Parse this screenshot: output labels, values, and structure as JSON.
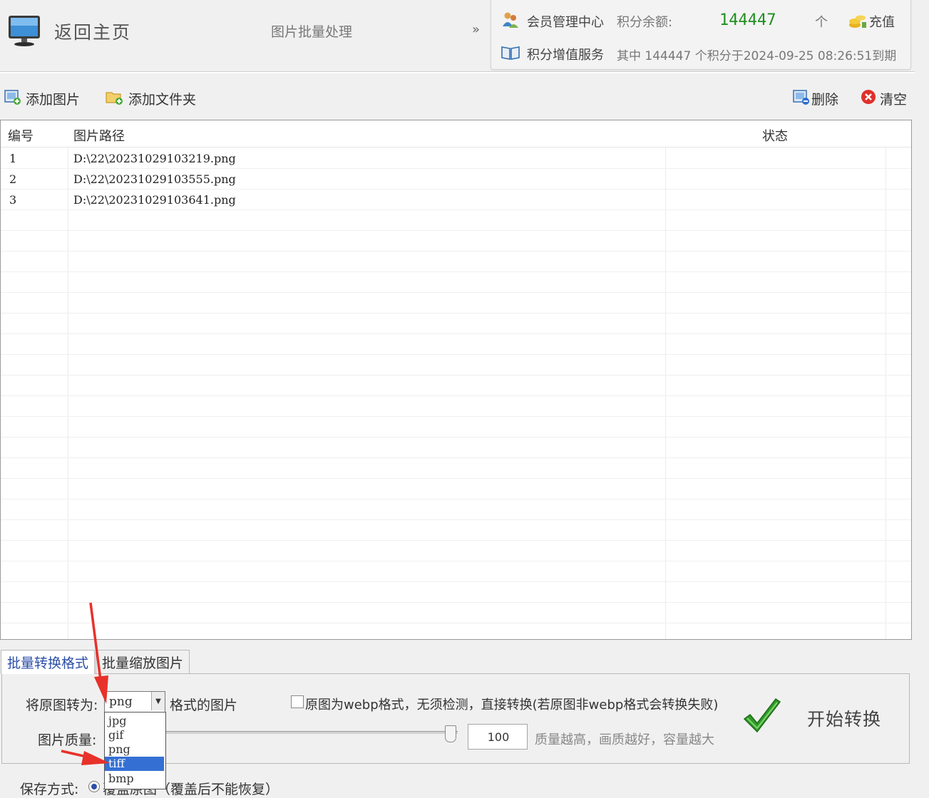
{
  "header": {
    "home_label": "返回主页",
    "module_title": "图片批量处理",
    "collapse_glyph": "»",
    "member_center": "会员管理中心",
    "balance_label": "积分余额:",
    "balance_value": "144447",
    "balance_unit": "个",
    "recharge_label": "充值",
    "value_service": "积分增值服务",
    "expiry_text": "其中 144447 个积分于2024-09-25 08:26:51到期",
    "icons": [
      "monitor-icon",
      "members-icon",
      "coins-icon",
      "book-icon"
    ]
  },
  "toolbar": {
    "add_image": "添加图片",
    "add_folder": "添加文件夹",
    "delete": "删除",
    "clear": "清空"
  },
  "table": {
    "columns": [
      "编号",
      "图片路径",
      "状态"
    ],
    "rows": [
      {
        "id": "1",
        "path": "D:\\22\\20231029103219.png",
        "status": ""
      },
      {
        "id": "2",
        "path": "D:\\22\\20231029103555.png",
        "status": ""
      },
      {
        "id": "3",
        "path": "D:\\22\\20231029103641.png",
        "status": ""
      }
    ]
  },
  "tabs": [
    {
      "label": "批量转换格式",
      "active": true
    },
    {
      "label": "批量缩放图片",
      "active": false
    }
  ],
  "convert": {
    "convert_label": "将原图转为:",
    "selected_format": "png",
    "format_suffix": "格式的图片",
    "format_options": [
      "jpg",
      "gif",
      "png",
      "tiff",
      "bmp"
    ],
    "highlighted_option": "tiff",
    "webp_checkbox_label": "原图为webp格式，无须检测，直接转换(若原图非webp格式会转换失败)",
    "webp_checked": false,
    "quality_label": "图片质量:",
    "quality_value": "100",
    "quality_hint": "质量越高，画质越好，容量越大",
    "start_button": "开始转换",
    "save_label": "保存方式:",
    "save_option": "覆盖原图（覆盖后不能恢复）"
  },
  "colors": {
    "balance": "#1f8f1f",
    "active_tab_text": "#2a4ea8",
    "selected_option": "#3470d4",
    "annotation_arrow": "#e8312a"
  }
}
